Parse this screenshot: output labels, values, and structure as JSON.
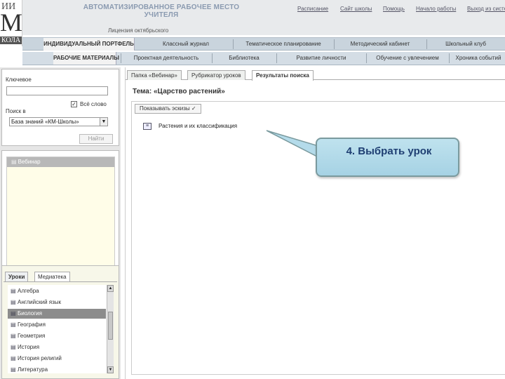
{
  "header": {
    "logo_top": "ИИ",
    "logo_mid": "М",
    "logo_bottom": "КОЛА",
    "app_title": "АВТОМАТИЗИРОВАННОЕ РАБОЧЕЕ МЕСТО УЧИТЕЛЯ",
    "school": "Лицензия октябрьского",
    "links": [
      "Расписание",
      "Сайт школы",
      "Помощь",
      "Начало работы",
      "Выход из системы"
    ]
  },
  "nav1": {
    "active": "ИНДИВИДУАЛЬНЫЙ ПОРТФЕЛЬ",
    "items": [
      "Классный журнал",
      "Тематическое планирование",
      "Методический кабинет",
      "Школьный клуб"
    ]
  },
  "nav2": {
    "active": "РАБОЧИЕ МАТЕРИАЛЫ",
    "items": [
      "Проектная деятельность",
      "Библиотека",
      "Развитие личности",
      "Обучение с увлечением",
      "Хроника событий"
    ]
  },
  "search": {
    "keywords_label": "Ключевое",
    "keywords_value": "",
    "everywhere_label": "Всё слово",
    "everywhere_checked": "✓",
    "where_label": "Поиск в",
    "source_value": "База знаний «КМ-Школы»",
    "find_label": "Найти"
  },
  "tree": {
    "item": "Вебинар"
  },
  "lessons": {
    "tabs": [
      "Уроки",
      "Медиатека"
    ],
    "items": [
      "Алгебра",
      "Английский язык",
      "Биология",
      "География",
      "Геометрия",
      "История",
      "История религий",
      "Литература"
    ],
    "selected_index": 2
  },
  "main": {
    "tabs": [
      "Папка «Вебинар»",
      "Рубрикатор уроков",
      "Результаты поиска"
    ],
    "topic": "Тема: «Царство растений»",
    "show_button": "Показывать эскизы",
    "result": "Растения и их классификация"
  },
  "callout": {
    "text": "4. Выбрать урок"
  },
  "colors": {
    "callout_fill": "#b4dbea",
    "callout_text": "#1e3e72",
    "nav_bg": "#c9d4dd",
    "selected_row": "#8c8c8c"
  }
}
